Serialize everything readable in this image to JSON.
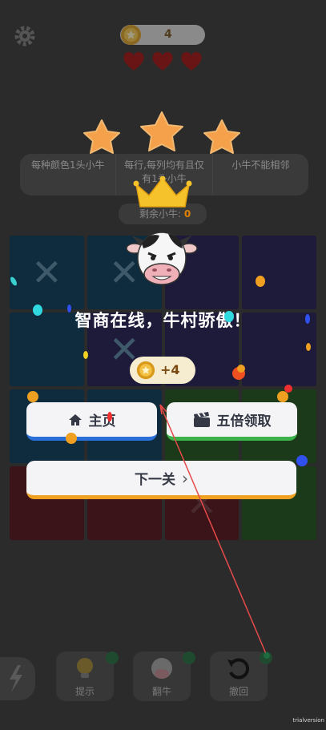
{
  "hud": {
    "coins": "4",
    "lives": 3
  },
  "rules": [
    "每种颜色1头小牛",
    "每行,每列均有且仅有1头小牛",
    "小牛不能相邻"
  ],
  "remaining": {
    "label": "剩余小牛:",
    "count": "0"
  },
  "tools": {
    "hint_label": "提示",
    "flip_label": "翻牛",
    "undo_label": "撤回"
  },
  "popup": {
    "stars_earned": 3,
    "title": "智商在线，牛村骄傲！",
    "reward": "+4",
    "home_label": "主页",
    "five_times_label": "五倍领取",
    "next_label": "下一关"
  },
  "version_tag": "trialversion",
  "colors": {
    "home_accent": "#2a6fd8",
    "five_accent": "#3bb24a",
    "next_accent": "#f0a020",
    "star": "#f5a04a",
    "crown": "#f6c22c"
  }
}
